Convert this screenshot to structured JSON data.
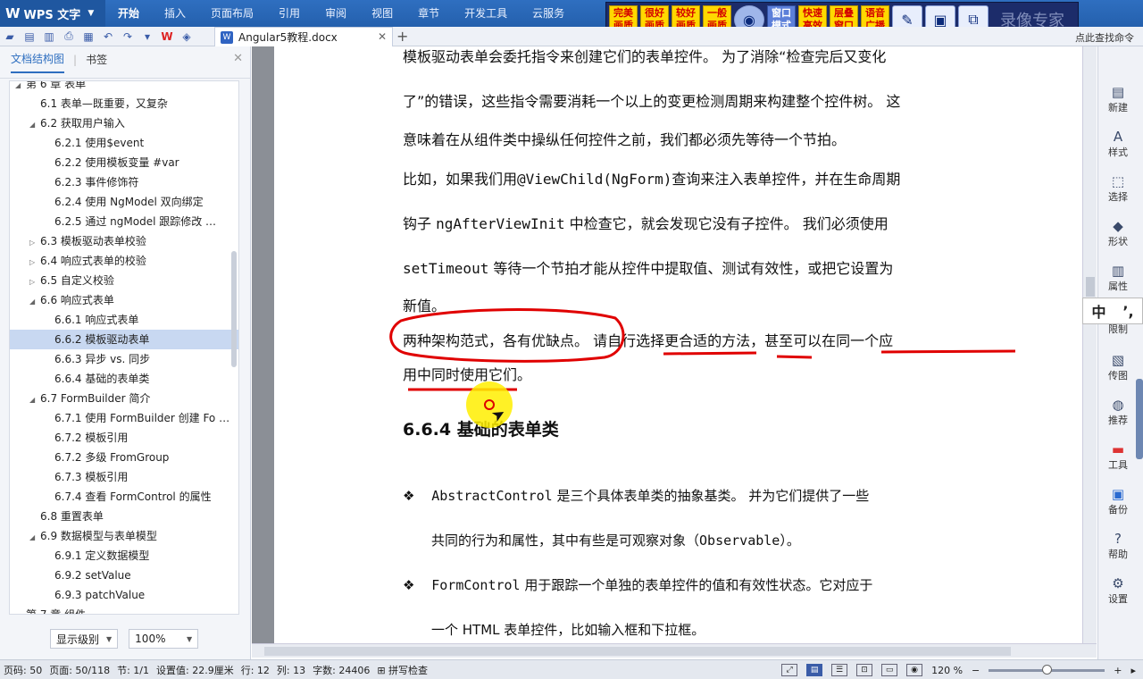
{
  "app": {
    "name": "WPS 文字",
    "menu": [
      "开始",
      "插入",
      "页面布局",
      "引用",
      "审阅",
      "视图",
      "章节",
      "开发工具",
      "云服务"
    ],
    "active_menu": "开始"
  },
  "floatbar": {
    "buttons": [
      "完美画质",
      "很好画质",
      "较好画质",
      "一般画质",
      "窗口模式",
      "快速高效",
      "层叠窗口",
      "语音广播"
    ],
    "faint_text": "录像专家"
  },
  "tabs": {
    "document": "Angular5教程.docx",
    "right_hint": "点此查找命令"
  },
  "nav": {
    "tab_outline": "文档结构图",
    "tab_bookmark": "书签",
    "items": [
      {
        "label": "第 6 章 表单",
        "level": 1,
        "toggle": "expanded"
      },
      {
        "label": "6.1  表单—既重要，又复杂",
        "level": 2,
        "toggle": "none"
      },
      {
        "label": "6.2  获取用户输入",
        "level": 2,
        "toggle": "expanded"
      },
      {
        "label": "6.2.1  使用$event",
        "level": 3,
        "toggle": "none"
      },
      {
        "label": "6.2.2  使用模板变量 #var",
        "level": 3,
        "toggle": "none"
      },
      {
        "label": "6.2.3  事件修饰符",
        "level": 3,
        "toggle": "none"
      },
      {
        "label": "6.2.4  使用 NgModel 双向绑定",
        "level": 3,
        "toggle": "none"
      },
      {
        "label": "6.2.5  通过  ngModel  跟踪修改 …",
        "level": 3,
        "toggle": "none"
      },
      {
        "label": "6.3  模板驱动表单校验",
        "level": 2,
        "toggle": "collapsed"
      },
      {
        "label": "6.4  响应式表单的校验",
        "level": 2,
        "toggle": "collapsed"
      },
      {
        "label": "6.5 自定义校验",
        "level": 2,
        "toggle": "collapsed"
      },
      {
        "label": "6.6  响应式表单",
        "level": 2,
        "toggle": "expanded"
      },
      {
        "label": "6.6.1  响应式表单",
        "level": 3,
        "toggle": "none"
      },
      {
        "label": "6.6.2  模板驱动表单",
        "level": 3,
        "toggle": "none",
        "selected": true
      },
      {
        "label": "6.6.3  异步  vs.  同步",
        "level": 3,
        "toggle": "none"
      },
      {
        "label": "6.6.4  基础的表单类",
        "level": 3,
        "toggle": "none"
      },
      {
        "label": "6.7 FormBuilder 简介",
        "level": 2,
        "toggle": "expanded"
      },
      {
        "label": "6.7.1  使用 FormBuilder 创建 Fo …",
        "level": 3,
        "toggle": "none"
      },
      {
        "label": "6.7.2  模板引用",
        "level": 3,
        "toggle": "none"
      },
      {
        "label": "6.7.2  多级 FromGroup",
        "level": 3,
        "toggle": "none"
      },
      {
        "label": "6.7.3  模板引用",
        "level": 3,
        "toggle": "none"
      },
      {
        "label": "6.7.4  查看 FormControl 的属性",
        "level": 3,
        "toggle": "none"
      },
      {
        "label": "6.8  重置表单",
        "level": 2,
        "toggle": "none"
      },
      {
        "label": "6.9  数据模型与表单模型",
        "level": 2,
        "toggle": "expanded"
      },
      {
        "label": "6.9.1  定义数据模型",
        "level": 3,
        "toggle": "none"
      },
      {
        "label": "6.9.2 setValue",
        "level": 3,
        "toggle": "none"
      },
      {
        "label": "6.9.3 patchValue",
        "level": 3,
        "toggle": "none"
      },
      {
        "label": "第 7 章  组件",
        "level": 1,
        "toggle": "expanded"
      }
    ],
    "display_level": "显示级别",
    "zoom": "100%"
  },
  "doc": {
    "line1": "模板驱动表单会委托指令来创建它们的表单控件。 为了消除“检查完后又变化",
    "line2": "了”的错误，这些指令需要消耗一个以上的变更检测周期来构建整个控件树。 这",
    "line3": "意味着在从组件类中操纵任何控件之前，我们都必须先等待一个节拍。",
    "line4a": "比如，如果我们用",
    "line4code": "@ViewChild(NgForm)",
    "line4b": "查询来注入表单控件，并在生命周期",
    "line5a": "钩子 ",
    "line5code": "ngAfterViewInit",
    "line5b": " 中检查它，就会发现它没有子控件。 我们必须使用",
    "line6code": "setTimeout",
    "line6b": " 等待一个节拍才能从控件中提取值、测试有效性，或把它设置为",
    "line7": "新值。",
    "line8a": "两种架构范式，各有优缺点。",
    "line8b": " 请自行选择更合适的方法，甚至可以在同一个应",
    "line9": "用中同时使用它们。",
    "heading_num": "6.6.4",
    "heading_text": " 基础的表单类",
    "b1_code": "AbstractControl",
    "b1_text": " 是三个具体表单类的抽象基类。 并为它们提供了一些",
    "b1_cont": "共同的行为和属性，其中有些是可观察对象（",
    "b1_code2": "Observable",
    "b1_end": "）。",
    "b2_code": "FormControl",
    "b2_text": " 用于跟踪一个单独的表单控件的值和有效性状态。它对应于",
    "b2_cont": "一个 HTML 表单控件，比如输入框和下拉框。",
    "bullet_glyph": "❖"
  },
  "sidepanel": {
    "items": [
      "新建",
      "样式",
      "选择",
      "形状",
      "属性",
      "限制",
      "传图",
      "推荐",
      "工具",
      "备份",
      "帮助",
      "设置"
    ],
    "ime_left": "中",
    "ime_right": "’,"
  },
  "status": {
    "page_code": "页码: 50",
    "page": "页面: 50/118",
    "section": "节: 1/1",
    "setting": "设置值: 22.9厘米",
    "row": "行: 12",
    "col": "列: 13",
    "chars": "字数: 24406",
    "spell": "拼写检查",
    "zoom": "120 %",
    "zoom_fraction": 0.5
  },
  "colors": {
    "accent": "#2f6fc0",
    "annotation": "#e00000",
    "selection": "#c8d8f1"
  }
}
